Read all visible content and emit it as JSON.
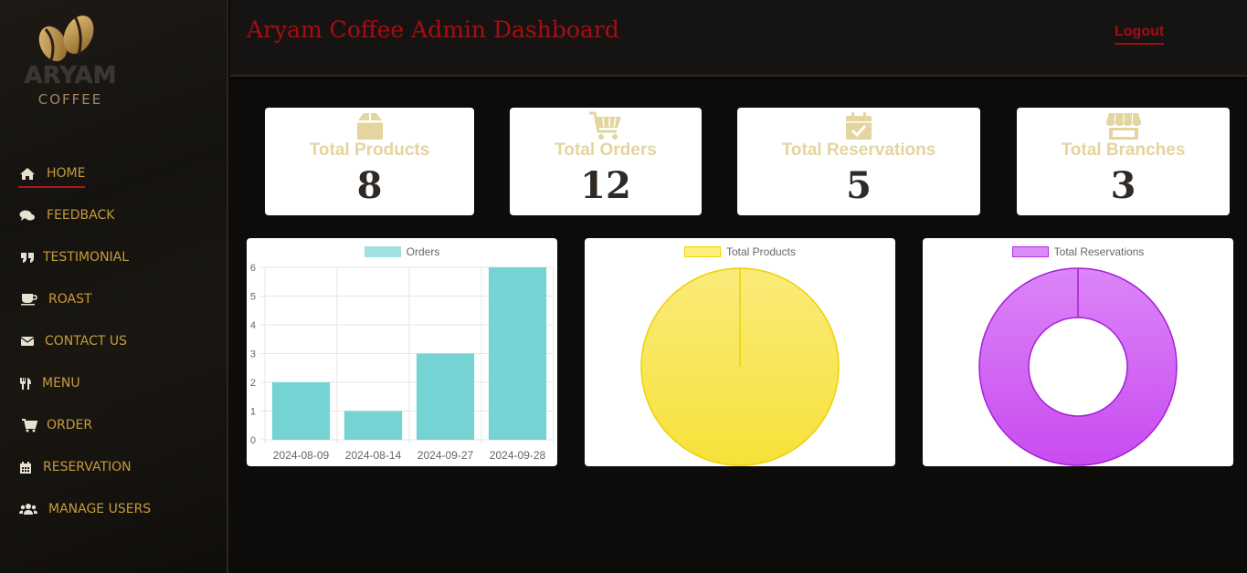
{
  "brand": {
    "name": "ARYAM",
    "tagline": "COFFEE"
  },
  "header": {
    "title": "Aryam Coffee Admin Dashboard",
    "logout": "Logout"
  },
  "sidebar": {
    "items": [
      {
        "label": "HOME",
        "icon": "home-icon",
        "active": true
      },
      {
        "label": "FEEDBACK",
        "icon": "comments-icon"
      },
      {
        "label": "TESTIMONIAL",
        "icon": "quote-icon"
      },
      {
        "label": "ROAST",
        "icon": "coffee-cup-icon"
      },
      {
        "label": "CONTACT US",
        "icon": "envelope-icon"
      },
      {
        "label": "MENU",
        "icon": "utensils-icon"
      },
      {
        "label": "ORDER",
        "icon": "cart-icon"
      },
      {
        "label": "RESERVATION",
        "icon": "calendar-icon"
      },
      {
        "label": "MANAGE USERS",
        "icon": "users-icon"
      }
    ]
  },
  "cards": [
    {
      "label": "Total Products",
      "value": "8",
      "icon": "box-icon"
    },
    {
      "label": "Total Orders",
      "value": "12",
      "icon": "cart-icon"
    },
    {
      "label": "Total Reservations",
      "value": "5",
      "icon": "calendar-check-icon"
    },
    {
      "label": "Total Branches",
      "value": "3",
      "icon": "store-icon"
    }
  ],
  "colors": {
    "accent_red": "#a50d12",
    "gold": "#c79a3b",
    "card_label": "#e2d59e",
    "orders_bar": "#75d3d3",
    "products_pie": "#f7e23a",
    "reservations_doughnut": "#c84bf0"
  },
  "chart_data": [
    {
      "type": "bar",
      "categories": [
        "2024-08-09",
        "2024-08-14",
        "2024-09-27",
        "2024-09-28"
      ],
      "series": [
        {
          "name": "Orders",
          "values": [
            2,
            1,
            3,
            6
          ]
        }
      ],
      "ylim": [
        0,
        6
      ],
      "yticks": [
        0,
        1,
        2,
        3,
        4,
        5,
        6
      ],
      "grid": true,
      "legend": "top"
    },
    {
      "type": "pie",
      "categories": [
        "Total Products"
      ],
      "series": [
        {
          "name": "Total Products",
          "values": [
            8
          ]
        }
      ],
      "legend": "top"
    },
    {
      "type": "pie",
      "subtype": "doughnut",
      "categories": [
        "Total Reservations"
      ],
      "series": [
        {
          "name": "Total Reservations",
          "values": [
            5
          ]
        }
      ],
      "legend": "top"
    }
  ]
}
